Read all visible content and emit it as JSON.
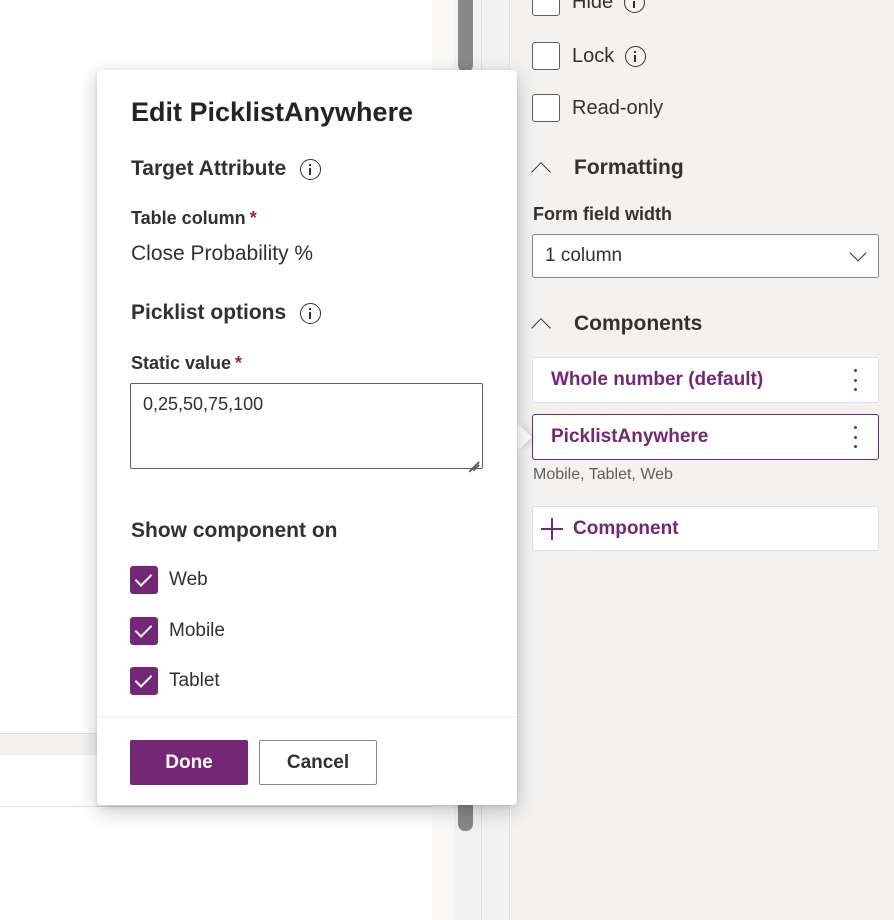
{
  "properties_pane": {
    "checkboxes": [
      {
        "label": "Hide",
        "has_info": true,
        "checked": false
      },
      {
        "label": "Lock",
        "has_info": true,
        "checked": false
      },
      {
        "label": "Read-only",
        "has_info": false,
        "checked": false
      }
    ],
    "formatting": {
      "title": "Formatting",
      "width_label": "Form field width",
      "width_value": "1 column"
    },
    "components": {
      "title": "Components",
      "items": [
        {
          "label": "Whole number (default)",
          "selected": false
        },
        {
          "label": "PicklistAnywhere",
          "selected": true
        }
      ],
      "selected_platforms": "Mobile, Tablet, Web",
      "add_label": "Component"
    }
  },
  "popup": {
    "title": "Edit PicklistAnywhere",
    "target_attribute_heading": "Target Attribute",
    "table_column_label": "Table column",
    "table_column_value": "Close Probability %",
    "picklist_options_heading": "Picklist options",
    "static_value_label": "Static value",
    "static_value": "0,25,50,75,100",
    "required_mark": "*",
    "show_on_heading": "Show component on",
    "show_on": [
      {
        "label": "Web",
        "checked": true
      },
      {
        "label": "Mobile",
        "checked": true
      },
      {
        "label": "Tablet",
        "checked": true
      }
    ],
    "done_label": "Done",
    "cancel_label": "Cancel"
  },
  "colors": {
    "accent": "#742774",
    "pane_bg": "#f3f2f1",
    "required": "#a4262c"
  }
}
